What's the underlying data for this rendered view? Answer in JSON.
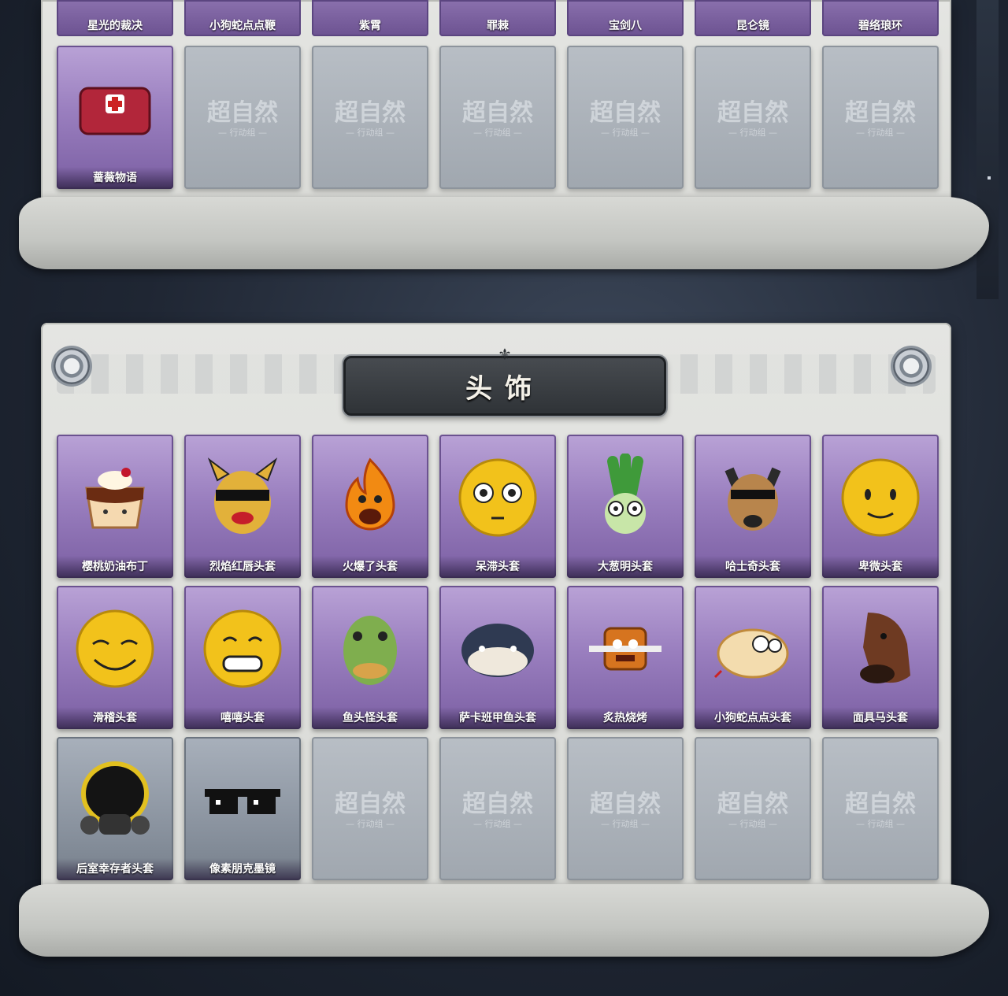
{
  "top_section": {
    "strip_labels": [
      "星光的裁决",
      "小狗蛇点点鞭",
      "紫霄",
      "罪棘",
      "宝剑八",
      "昆仑镜",
      "碧络琅环"
    ],
    "row2": [
      {
        "label": "蔷薇物语",
        "rarity": "purple",
        "icon": "first-aid-bag-icon"
      },
      {
        "placeholder": true
      },
      {
        "placeholder": true
      },
      {
        "placeholder": true
      },
      {
        "placeholder": true
      },
      {
        "placeholder": true
      },
      {
        "placeholder": true
      }
    ]
  },
  "headwear_section": {
    "title": "头饰",
    "items": [
      {
        "label": "樱桃奶油布丁",
        "rarity": "purple",
        "icon": "pudding-icon"
      },
      {
        "label": "烈焰红唇头套",
        "rarity": "purple",
        "icon": "pikachu-mask-icon"
      },
      {
        "label": "火爆了头套",
        "rarity": "purple",
        "icon": "flame-face-icon"
      },
      {
        "label": "呆滞头套",
        "rarity": "purple",
        "icon": "dazed-emoji-icon"
      },
      {
        "label": "大葱明头套",
        "rarity": "purple",
        "icon": "scallion-icon"
      },
      {
        "label": "哈士奇头套",
        "rarity": "purple",
        "icon": "husky-icon"
      },
      {
        "label": "卑微头套",
        "rarity": "purple",
        "icon": "humble-emoji-icon"
      },
      {
        "label": "滑稽头套",
        "rarity": "purple",
        "icon": "funny-emoji-icon"
      },
      {
        "label": "嘻嘻头套",
        "rarity": "purple",
        "icon": "grin-emoji-icon"
      },
      {
        "label": "鱼头怪头套",
        "rarity": "purple",
        "icon": "fish-head-icon"
      },
      {
        "label": "萨卡班甲鱼头套",
        "rarity": "purple",
        "icon": "sacabambaspis-icon"
      },
      {
        "label": "炙热烧烤",
        "rarity": "purple",
        "icon": "bbq-icon"
      },
      {
        "label": "小狗蛇点点头套",
        "rarity": "purple",
        "icon": "dog-snake-icon"
      },
      {
        "label": "面具马头套",
        "rarity": "purple",
        "icon": "horse-mask-icon"
      },
      {
        "label": "后室幸存者头套",
        "rarity": "gray",
        "icon": "gas-mask-helmet-icon"
      },
      {
        "label": "像素朋克墨镜",
        "rarity": "gray",
        "icon": "pixel-sunglasses-icon"
      },
      {
        "placeholder": true
      },
      {
        "placeholder": true
      },
      {
        "placeholder": true
      },
      {
        "placeholder": true
      },
      {
        "placeholder": true
      }
    ]
  },
  "watermark": {
    "main": "超自然",
    "sub": "— 行动组 —"
  },
  "colors": {
    "purple_card": "#9a7fbf",
    "gray_card": "#8b94a0",
    "panel": "#e4e5e2",
    "title_plate": "#3a3e43"
  }
}
